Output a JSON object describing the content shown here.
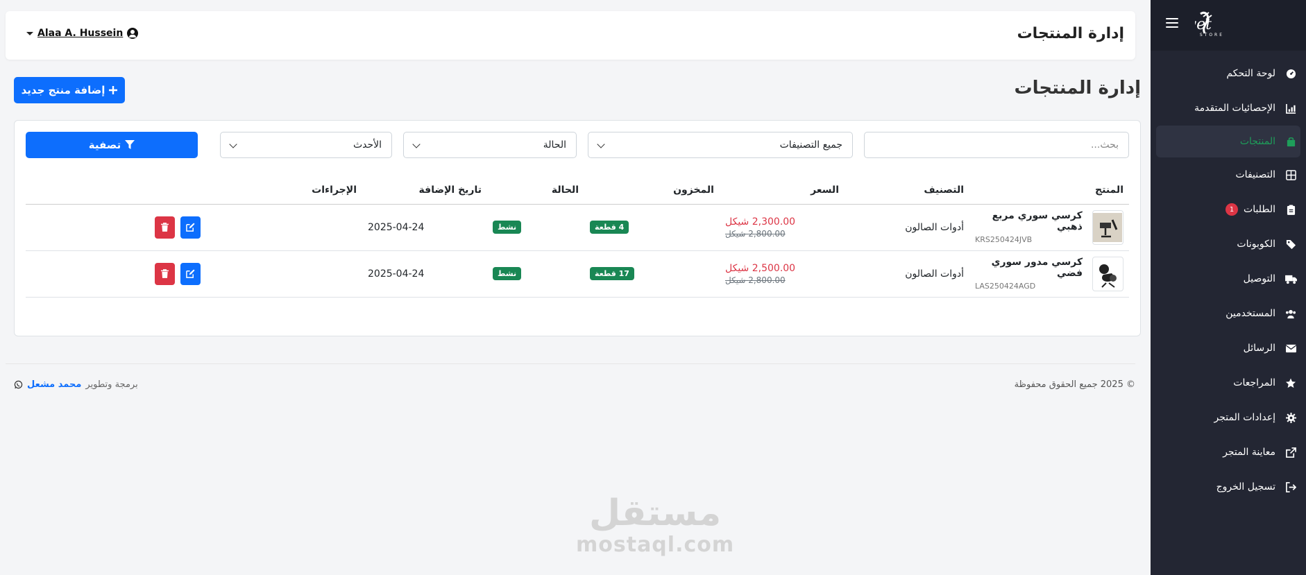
{
  "sidebar": {
    "brand": "Velvet",
    "brand_sub": "STORE",
    "items": [
      {
        "label": "لوحة التحكم",
        "icon": "dashboard-icon"
      },
      {
        "label": "الإحصائيات المتقدمة",
        "icon": "chart-icon"
      },
      {
        "label": "المنتجات",
        "icon": "shopping-bag-icon",
        "active": true
      },
      {
        "label": "التصنيفات",
        "icon": "grid-icon"
      },
      {
        "label": "الطلبات",
        "icon": "clipboard-icon",
        "badge": "1"
      },
      {
        "label": "الكوبونات",
        "icon": "tags-icon"
      },
      {
        "label": "التوصيل",
        "icon": "truck-icon"
      },
      {
        "label": "المستخدمين",
        "icon": "users-icon"
      },
      {
        "label": "الرسائل",
        "icon": "envelope-icon"
      },
      {
        "label": "المراجعات",
        "icon": "star-icon"
      },
      {
        "label": "إعدادات المتجر",
        "icon": "gear-icon"
      },
      {
        "label": "معاينة المتجر",
        "icon": "external-link-icon"
      },
      {
        "label": "تسجيل الخروج",
        "icon": "sign-out-icon"
      }
    ]
  },
  "topbar": {
    "title": "إدارة المنتجات",
    "user_name": "Alaa A. Hussein"
  },
  "page": {
    "title": "إدارة المنتجات",
    "add_button": "إضافة منتج جديد"
  },
  "filters": {
    "search_placeholder": "بحث...",
    "category": "جميع التصنيفات",
    "status": "الحالة",
    "sort": "الأحدث",
    "filter_button": "تصفية"
  },
  "table": {
    "headers": {
      "product": "المنتج",
      "category": "التصنيف",
      "price": "السعر",
      "stock": "المخزون",
      "status": "الحالة",
      "date": "تاريخ الإضافة",
      "actions": "الإجراءات"
    },
    "rows": [
      {
        "name": "كرسي سوري مربع ذهبي",
        "sku": "KRS250424JVB",
        "category": "أدوات الصالون",
        "price": "2,300.00 شيكل",
        "old_price": "2,800.00 شيكل",
        "stock": "4 قطعة",
        "status": "نشط",
        "date": "2025-04-24"
      },
      {
        "name": "كرسي مدور سوري فضي",
        "sku": "LAS250424AGD",
        "category": "أدوات الصالون",
        "price": "2,500.00 شيكل",
        "old_price": "2,800.00 شيكل",
        "stock": "17 قطعة",
        "status": "نشط",
        "date": "2025-04-24"
      }
    ]
  },
  "footer": {
    "copyright": "© 2025 جميع الحقوق محفوظة",
    "credit_prefix": "برمجة وتطوير",
    "credit_author": "محمد مشعل"
  },
  "watermark": {
    "arabic": "مستقل",
    "latin": "mostaql.com"
  }
}
